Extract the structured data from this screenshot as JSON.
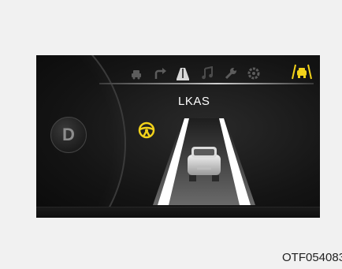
{
  "display": {
    "mode_label": "LKAS",
    "gear_label": "D",
    "tabs": [
      {
        "icon": "car-info-icon"
      },
      {
        "icon": "turn-arrow-icon"
      },
      {
        "icon": "lane-road-icon"
      },
      {
        "icon": "music-note-icon"
      },
      {
        "icon": "wrench-icon"
      },
      {
        "icon": "settings-gear-icon"
      },
      {
        "icon": "lane-assist-car-icon"
      }
    ],
    "active_tab": "lane-road-icon",
    "colors": {
      "accent": "#f2d21a",
      "background": "#141414",
      "lane_line": "#ffffff"
    }
  },
  "figure_code": "OTF054083"
}
